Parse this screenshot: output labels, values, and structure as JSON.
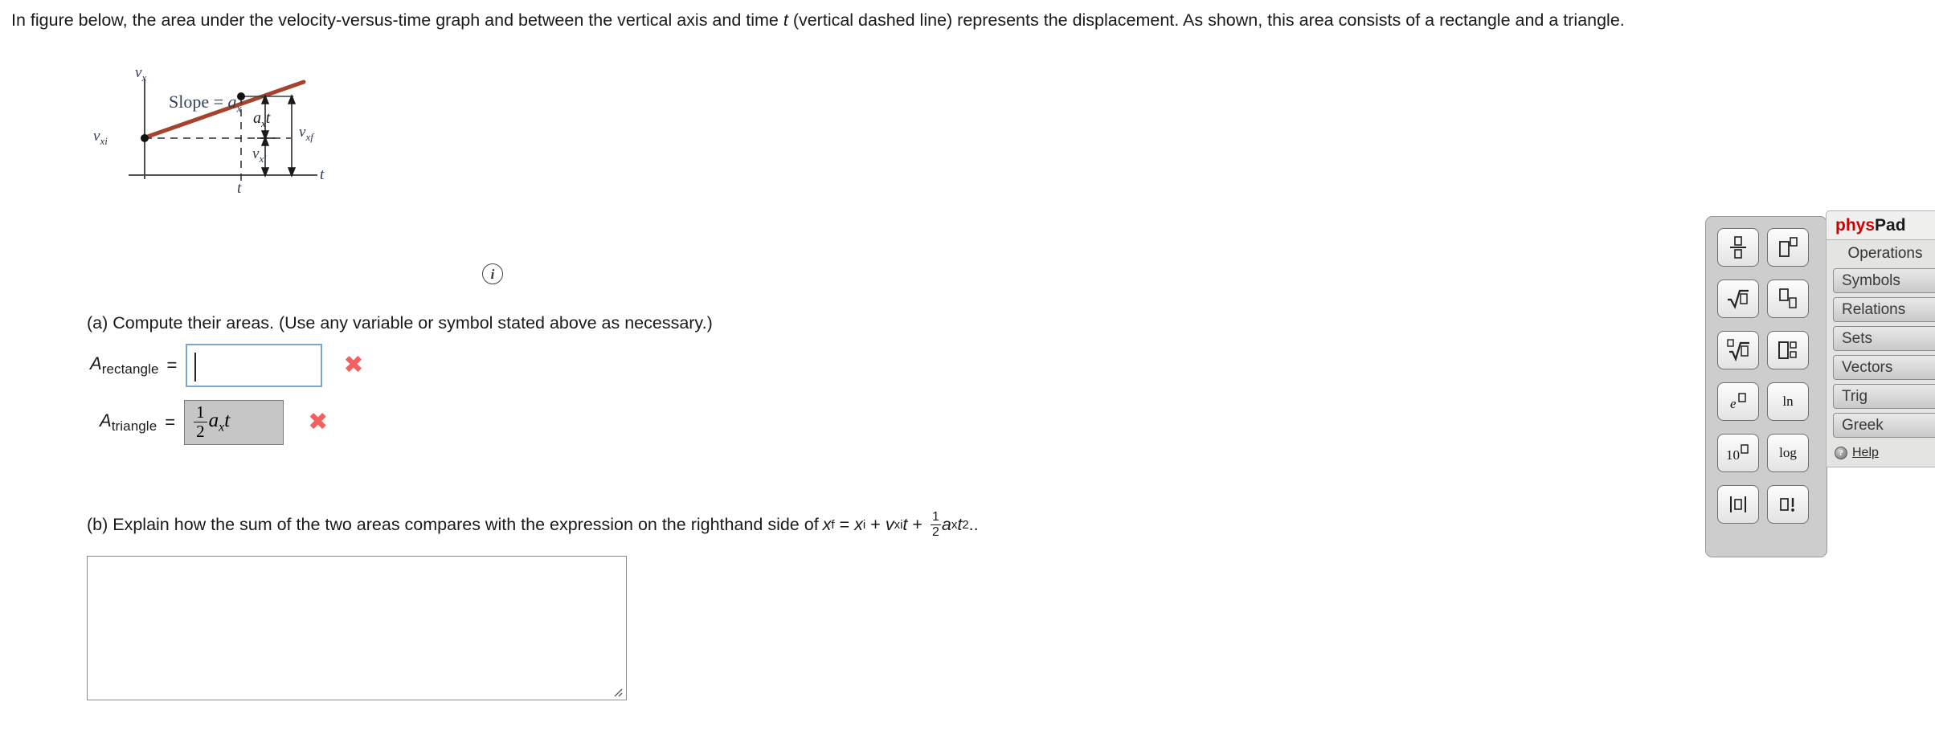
{
  "problem": {
    "intro_part1": "In figure below, the area under the velocity-versus-time graph and between the vertical axis and time ",
    "intro_var": "t",
    "intro_part2": " (vertical dashed line) represents the displacement. As shown, this area consists of a rectangle and a triangle."
  },
  "figure": {
    "y_axis_label": "v",
    "y_axis_sub": "x",
    "x_axis_label": "t",
    "slope_label": "Slope  =",
    "slope_value": "a",
    "slope_value_sub": "x",
    "v_initial_label": "v",
    "v_initial_sub": "xi",
    "v_final_label": "v",
    "v_final_sub": "xf",
    "axt_label": "a",
    "axt_sub": "x",
    "axt_suffix": "t",
    "vxi_inner_label": "v",
    "vxi_inner_sub": "xi",
    "time_tick_label": "t",
    "line_color": "#a6432f",
    "info_icon_label": "i"
  },
  "part_a": {
    "prompt": "(a) Compute their areas. (Use any variable or symbol stated above as necessary.)",
    "rectangle": {
      "label_base": "A",
      "label_sub": "rectangle",
      "equals": "=",
      "value": "",
      "status": "incorrect",
      "status_mark": "✖"
    },
    "triangle": {
      "label_base": "A",
      "label_sub": "triangle",
      "equals": "=",
      "value_frac_num": "1",
      "value_frac_den": "2",
      "value_var": "a",
      "value_var_sub": "x",
      "value_var_suffix": "t",
      "status": "incorrect",
      "status_mark": "✖"
    }
  },
  "part_b": {
    "prompt": "(b) Explain how the sum of the two areas compares with the expression on the righthand side of",
    "equation": {
      "lhs_base": "x",
      "lhs_sub": "f",
      "equals": "=",
      "t1_base": "x",
      "t1_sub": "i",
      "plus1": "+",
      "t2_base": "v",
      "t2_sub": "xi",
      "t2_suffix": "t",
      "plus2": "+",
      "frac_num": "1",
      "frac_den": "2",
      "t3_base": "a",
      "t3_sub": "x",
      "t3_suffix": "t",
      "t3_sup": "2",
      "trailing": ".."
    },
    "answer_text": ""
  },
  "physpad": {
    "brand_red": "phys",
    "brand_black": "Pad",
    "section_label": "Operations",
    "tabs": [
      {
        "label": "Symbols"
      },
      {
        "label": "Relations"
      },
      {
        "label": "Sets"
      },
      {
        "label": "Vectors"
      },
      {
        "label": "Trig"
      },
      {
        "label": "Greek"
      }
    ],
    "help_label": "Help",
    "help_icon": "?",
    "keys": [
      {
        "name": "fraction",
        "text": ""
      },
      {
        "name": "superscript",
        "text": ""
      },
      {
        "name": "square-root",
        "text": ""
      },
      {
        "name": "subscript",
        "text": ""
      },
      {
        "name": "nth-root",
        "text": ""
      },
      {
        "name": "matrix",
        "text": ""
      },
      {
        "name": "exponential",
        "text": ""
      },
      {
        "name": "natural-log",
        "text": "ln"
      },
      {
        "name": "power-of-ten",
        "text": ""
      },
      {
        "name": "log",
        "text": "log"
      },
      {
        "name": "absolute-value",
        "text": ""
      },
      {
        "name": "factorial",
        "text": ""
      }
    ]
  },
  "colors": {
    "graph_line": "#a6432f",
    "input_focus_border": "#7aa7cc",
    "incorrect_mark": "#f2605f",
    "brand_red": "#cc0000"
  }
}
